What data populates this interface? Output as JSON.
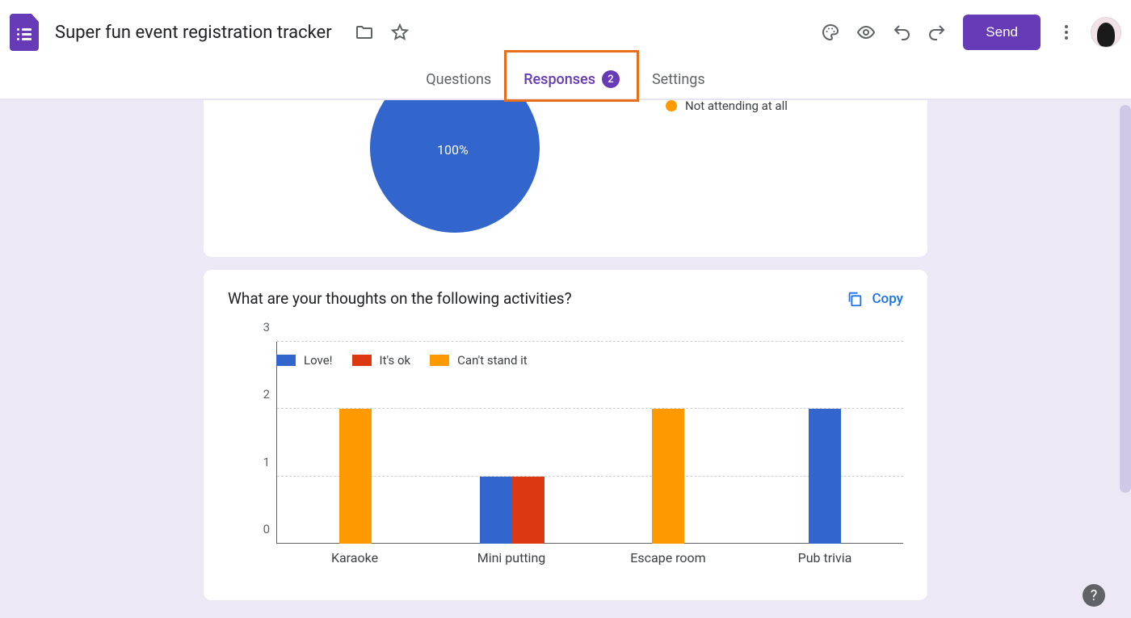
{
  "header": {
    "doc_title": "Super fun event registration tracker",
    "send_label": "Send"
  },
  "tabs": {
    "questions": "Questions",
    "responses": "Responses",
    "responses_count": "2",
    "settings": "Settings"
  },
  "pie_card": {
    "legend_not_attending": "Not attending at all",
    "center_label": "100%"
  },
  "bar_card": {
    "title": "What are your thoughts on the following activities?",
    "copy_label": "Copy"
  },
  "chart_data": {
    "type": "bar",
    "categories": [
      "Karaoke",
      "Mini putting",
      "Escape room",
      "Pub trivia"
    ],
    "series": [
      {
        "name": "Love!",
        "color": "#3366cc",
        "values": [
          0,
          1,
          0,
          2
        ]
      },
      {
        "name": "It's ok",
        "color": "#dc3912",
        "values": [
          0,
          1,
          0,
          0
        ]
      },
      {
        "name": "Can't stand it",
        "color": "#ff9900",
        "values": [
          2,
          0,
          2,
          0
        ]
      }
    ],
    "ylim": [
      0,
      3
    ],
    "y_ticks": [
      0,
      1,
      2,
      3
    ]
  },
  "pie_chart_data": {
    "type": "pie",
    "slices": [
      {
        "label": "Not attending at all",
        "value": 100,
        "color": "#ff9900"
      }
    ],
    "visible_slice_color": "#3366cc",
    "visible_slice_pct": "100%"
  },
  "colors": {
    "primary": "#673ab7",
    "blue": "#3366cc",
    "red": "#dc3912",
    "orange": "#ff9900",
    "link": "#1a73e8",
    "highlight": "#e76f1b"
  }
}
